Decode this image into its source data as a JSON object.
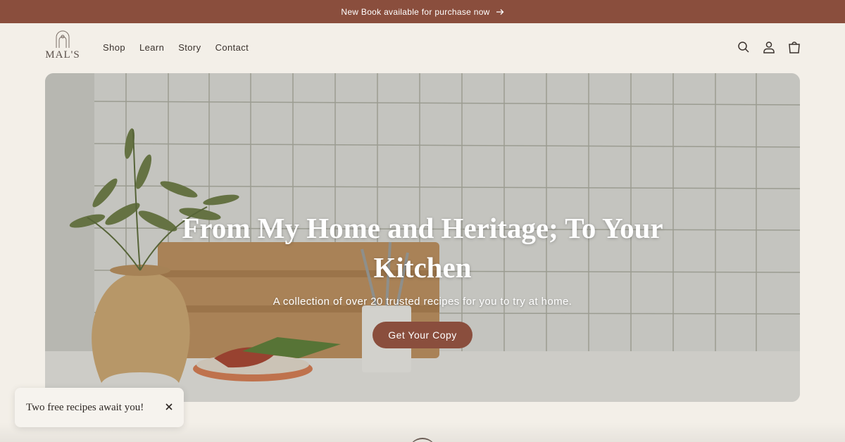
{
  "announcement": {
    "text": "New Book available for purchase now",
    "icon": "arrow-right-icon"
  },
  "header": {
    "logo_text": "MAL'S",
    "nav": [
      "Shop",
      "Learn",
      "Story",
      "Contact"
    ],
    "icons": [
      "search-icon",
      "account-icon",
      "cart-icon"
    ]
  },
  "hero": {
    "title": "From My Home and Heritage; To Your Kitchen",
    "subtitle": "A collection of over 20 trusted recipes for you to try at home.",
    "cta_label": "Get Your Copy"
  },
  "popup": {
    "text": "Two free recipes await you!"
  },
  "colors": {
    "brand": "#8a4e3d",
    "background": "#f3efe8",
    "text": "#3a322d"
  }
}
